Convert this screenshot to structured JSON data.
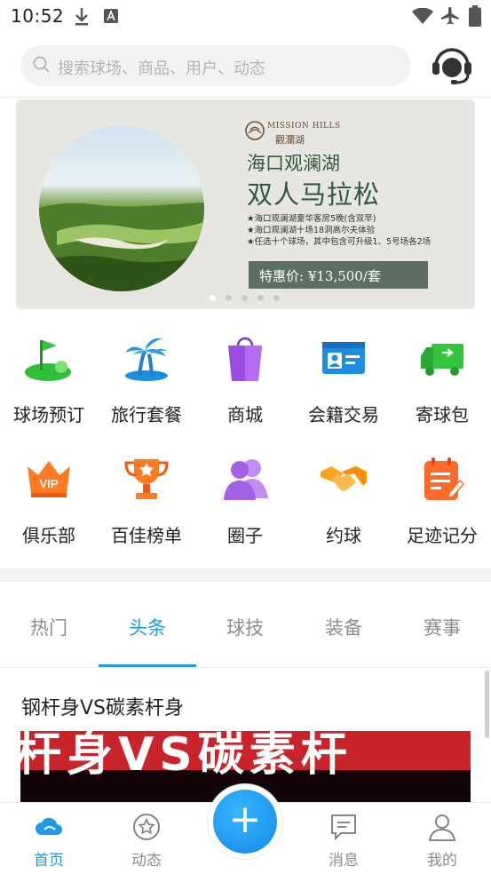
{
  "status_bar": {
    "time": "10:52"
  },
  "search": {
    "placeholder": "搜索球场、商品、用户、动态"
  },
  "banner": {
    "logo_en": "MISSION HILLS",
    "logo_cn": "觀瀾湖",
    "title_line1": "海口观澜湖",
    "title_line2": "双人马拉松",
    "bullets": [
      "★海口观澜湖豪华客房5晚(含双早)",
      "★海口观澜湖十场18洞高尔夫体验",
      "★任选十个球场，其中包含可升级1、5号场各2场"
    ],
    "price": "特惠价: ¥13,500/套",
    "slide_count": 5,
    "active_slide": 1
  },
  "features": [
    {
      "label": "球场预订",
      "icon": "golf-flag-icon"
    },
    {
      "label": "旅行套餐",
      "icon": "palm-island-icon"
    },
    {
      "label": "商城",
      "icon": "shopping-bag-icon"
    },
    {
      "label": "会籍交易",
      "icon": "member-card-icon"
    },
    {
      "label": "寄球包",
      "icon": "delivery-truck-icon"
    },
    {
      "label": "俱乐部",
      "icon": "vip-crown-icon"
    },
    {
      "label": "百佳榜单",
      "icon": "trophy-icon"
    },
    {
      "label": "圈子",
      "icon": "group-icon"
    },
    {
      "label": "约球",
      "icon": "handshake-icon"
    },
    {
      "label": "足迹记分",
      "icon": "scorecard-icon"
    }
  ],
  "tabs": [
    {
      "label": "热门",
      "active": false
    },
    {
      "label": "头条",
      "active": true
    },
    {
      "label": "球技",
      "active": false
    },
    {
      "label": "装备",
      "active": false
    },
    {
      "label": "赛事",
      "active": false
    }
  ],
  "article": {
    "title": "钢杆身VS碳素杆身",
    "image_caption": "杆身VS碳素杆"
  },
  "bottom_nav": [
    {
      "label": "首页",
      "icon": "cloud-home-icon",
      "active": true
    },
    {
      "label": "动态",
      "icon": "star-circle-icon",
      "active": false
    },
    {
      "label": "",
      "icon": "plus-icon",
      "active": false
    },
    {
      "label": "消息",
      "icon": "message-icon",
      "active": false
    },
    {
      "label": "我的",
      "icon": "user-icon",
      "active": false
    }
  ],
  "colors": {
    "accent": "#1e9ae6",
    "banner_text": "#2f5a3c"
  }
}
